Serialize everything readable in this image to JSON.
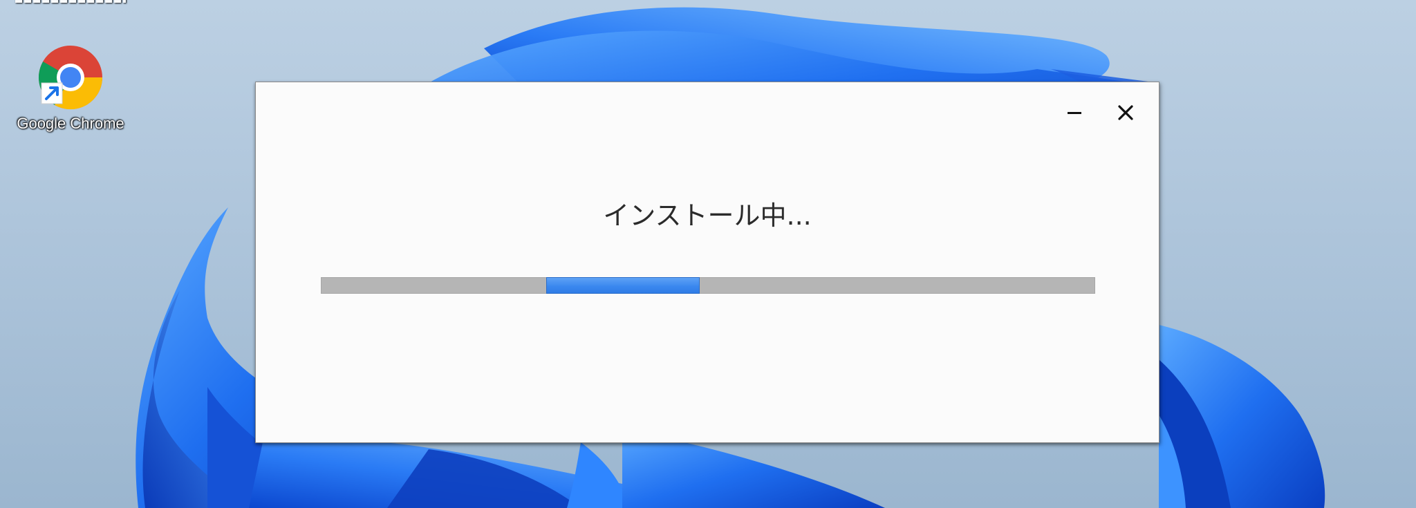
{
  "desktop": {
    "icons": [
      {
        "label": "Google Chrome",
        "icon": "chrome-shortcut-icon"
      }
    ]
  },
  "installer": {
    "status_text": "インストール中...",
    "controls": {
      "minimize_icon": "minimize-icon",
      "close_icon": "close-icon"
    },
    "progress": {
      "mode": "indeterminate",
      "chunk_start_fraction": 0.291,
      "chunk_width_fraction": 0.199
    }
  },
  "colors": {
    "progress_fill": "#3b88ef",
    "progress_track": "#b5b5b5",
    "dialog_background": "#fbfbfb"
  }
}
